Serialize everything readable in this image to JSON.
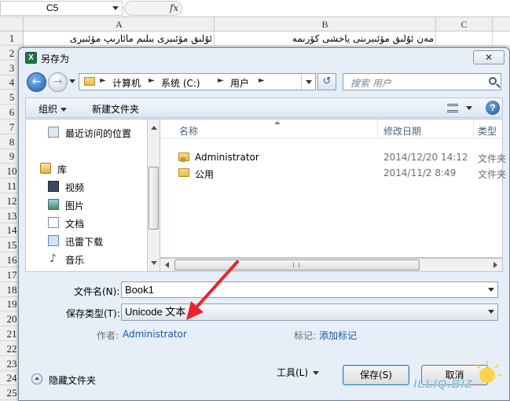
{
  "spreadsheet": {
    "name_box": "C5",
    "fx": "fx",
    "columns": [
      "A",
      "B",
      "C"
    ],
    "rows": [
      "1",
      "2",
      "3",
      "4",
      "5",
      "6",
      "7",
      "8",
      "9",
      "10",
      "11",
      "12",
      "13",
      "14",
      "15",
      "16",
      "17",
      "18",
      "19",
      "20",
      "21",
      "22",
      "23",
      "24",
      "25"
    ],
    "row1": {
      "a": "ئۇلىق مۆئىبرى بىلىم مائارىپ مۆئىبرى",
      "b": "مەن ئۇلىق مۆئىبرىنى ياخشى كۆرىمە"
    }
  },
  "dialog": {
    "title": "另存为",
    "close_label": "✕",
    "address": {
      "segments": [
        "计算机",
        "系统 (C:)",
        "用户"
      ]
    },
    "search_placeholder": "搜索 用户",
    "toolbar": {
      "organize": "组织",
      "new_folder": "新建文件夹"
    },
    "nav_pane": {
      "items": [
        {
          "label": "最近访问的位置",
          "icon": "recent-places-icon"
        },
        {
          "label": "库",
          "icon": "library-icon"
        },
        {
          "label": "视频",
          "icon": "video-icon"
        },
        {
          "label": "图片",
          "icon": "pictures-icon"
        },
        {
          "label": "文档",
          "icon": "documents-icon"
        },
        {
          "label": "迅雷下载",
          "icon": "download-icon"
        },
        {
          "label": "音乐",
          "icon": "music-icon"
        }
      ]
    },
    "file_list": {
      "columns": [
        "名称",
        "修改日期",
        "类型"
      ],
      "rows": [
        {
          "name": "Administrator",
          "date": "2014/12/20 14:12",
          "type": "文件夹"
        },
        {
          "name": "公用",
          "date": "2014/11/2 8:49",
          "type": "文件夹"
        }
      ]
    },
    "form": {
      "filename_label": "文件名(N):",
      "filename_value": "Book1",
      "type_label": "保存类型(T):",
      "type_value": "Unicode 文本",
      "author_label": "作者:",
      "author_value": "Administrator",
      "tags_label": "标记:",
      "tags_value": "添加标记"
    },
    "footer": {
      "hide_folders": "隐藏文件夹",
      "tools": "工具(L)",
      "save": "保存(S)",
      "cancel": "取消"
    }
  },
  "watermark": {
    "text": "ILLIQ.BIZ"
  },
  "colors": {
    "annotation_arrow": "#e8262a",
    "dialog_bg": "#e6eef8",
    "link": "#1a56a8"
  }
}
